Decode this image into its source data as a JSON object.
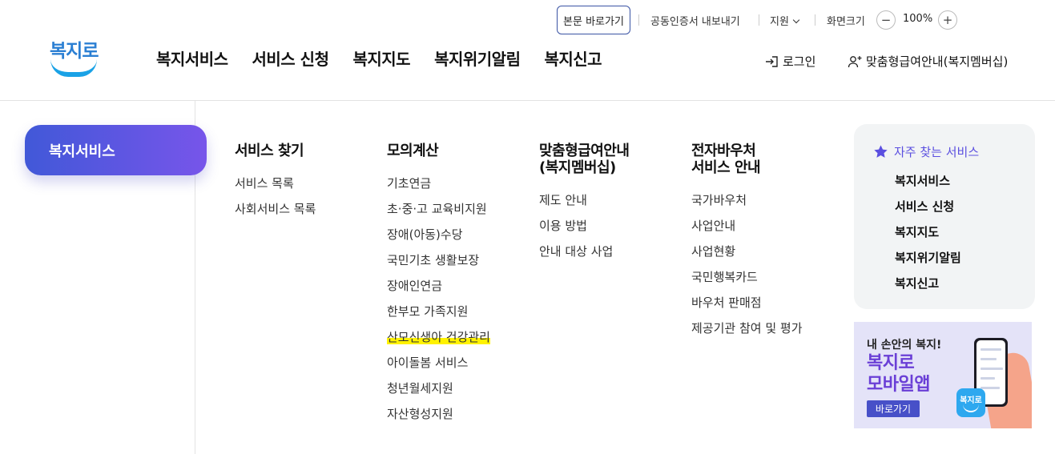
{
  "header": {
    "utility": {
      "skip_link": "본문 바로가기",
      "cert_export": "공동인증서 내보내기",
      "support": "지원",
      "zoom_label": "화면크기",
      "zoom_minus": "−",
      "zoom_value": "100%",
      "zoom_plus": "+"
    },
    "logo_text": "복지로",
    "gnb": [
      "복지서비스",
      "서비스 신청",
      "복지지도",
      "복지위기알림",
      "복지신고"
    ],
    "login": "로그인",
    "membership": "맞춤형급여안내(복지멤버십)"
  },
  "menu": {
    "category": "복지서비스",
    "columns": [
      {
        "title": "서비스 찾기",
        "links": [
          "서비스 목록",
          "사회서비스 목록"
        ]
      },
      {
        "title": "모의계산",
        "links": [
          "기초연금",
          "초·중·고 교육비지원",
          "장애(아동)수당",
          "국민기초 생활보장",
          "장애인연금",
          "한부모 가족지원",
          "산모신생아 건강관리",
          "아이돌봄 서비스",
          "청년월세지원",
          "자산형성지원"
        ]
      },
      {
        "title": "맞춤형급여안내\n(복지멤버십)",
        "links": [
          "제도 안내",
          "이용 방법",
          "안내 대상 사업"
        ]
      },
      {
        "title": "전자바우처\n서비스 안내",
        "links": [
          "국가바우처",
          "사업안내",
          "사업현황",
          "국민행복카드",
          "바우처 판매점",
          "제공기관 참여 및 평가"
        ]
      }
    ],
    "highlighted_link": "산모신생아 건강관리"
  },
  "favorites": {
    "title": "자주 찾는 서비스",
    "items": [
      "복지서비스",
      "서비스 신청",
      "복지지도",
      "복지위기알림",
      "복지신고"
    ]
  },
  "banner": {
    "line1": "내 손안의 복지!",
    "line2": "복지로\n모바일앱",
    "button": "바로가기",
    "app_icon_text": "복지로"
  },
  "colors": {
    "brand_blue": "#2b7fd3",
    "accent_purple": "#6a3fd6",
    "highlight": "#fff200"
  }
}
